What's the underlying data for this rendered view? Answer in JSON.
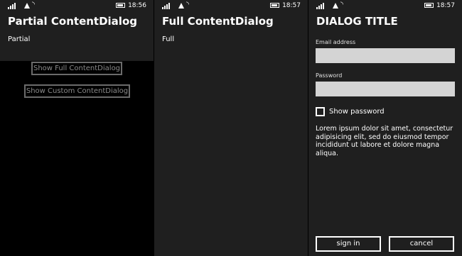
{
  "screens": [
    {
      "status": {
        "time": "18:56"
      },
      "title": "Partial ContentDialog",
      "subtitle": "Partial",
      "buttons": [
        "Show Full ContentDialog",
        "Show Custom ContentDialog"
      ]
    },
    {
      "status": {
        "time": "18:57"
      },
      "title": "Full ContentDialog",
      "subtitle": "Full"
    },
    {
      "status": {
        "time": "18:57"
      },
      "title": "DIALOG TITLE",
      "email_label": "Email address",
      "password_label": "Password",
      "show_password_label": "Show password",
      "body": "Lorem ipsum dolor sit amet, consectetur adipisicing elit, sed do eiusmod tempor incididunt ut labore et dolore magna aliqua.",
      "primary_button": "sign in",
      "secondary_button": "cancel"
    }
  ],
  "colors": {
    "dialog_bg": "#1f1f1f",
    "app_bg": "#000000",
    "field_bg": "#d4d4d4"
  }
}
